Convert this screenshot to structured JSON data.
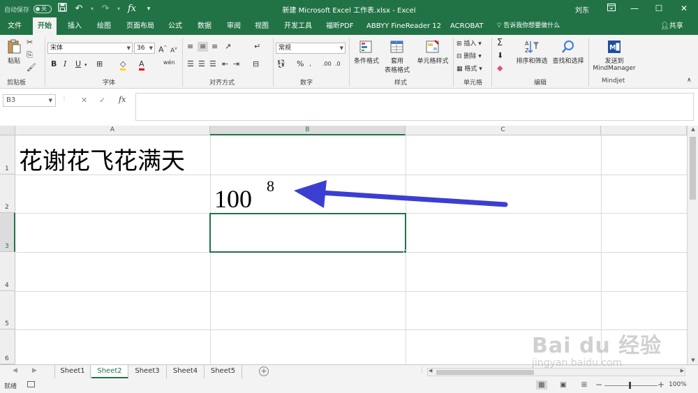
{
  "titlebar": {
    "autosave_label": "自动保存",
    "autosave_state": "关",
    "title": "新建 Microsoft Excel 工作表.xlsx  -  Excel",
    "user": "刘东",
    "icons": {
      "save": "save-icon",
      "undo": "undo-icon",
      "redo": "redo-icon",
      "fx": "fx",
      "customize": "▾"
    }
  },
  "tabs": {
    "items": [
      "文件",
      "开始",
      "插入",
      "绘图",
      "页面布局",
      "公式",
      "数据",
      "审阅",
      "视图",
      "开发工具",
      "福昕PDF",
      "ABBYY FineReader 12",
      "ACROBAT"
    ],
    "active": "开始",
    "tell_me": "告诉我你想要做什么",
    "share": "共享"
  },
  "ribbon": {
    "clipboard": {
      "paste": "粘贴",
      "label": "剪贴板"
    },
    "font": {
      "name": "宋体",
      "size": "36",
      "bold": "B",
      "italic": "I",
      "underline": "U",
      "label": "字体"
    },
    "alignment": {
      "label": "对齐方式"
    },
    "number": {
      "format": "常规",
      "percent": "%",
      "label": "数字"
    },
    "styles": {
      "conditional": "条件格式",
      "table1": "套用",
      "table2": "表格格式",
      "cell_styles": "单元格样式",
      "label": "样式"
    },
    "cells": {
      "insert": "插入",
      "delete": "删除",
      "format": "格式",
      "label": "单元格"
    },
    "editing": {
      "sort_filter": "排序和筛选",
      "find_select": "查找和选择",
      "label": "编辑"
    },
    "mindjet": {
      "send1": "发送到",
      "send2": "MindManager",
      "label": "Mindjet"
    }
  },
  "formula_bar": {
    "name_box": "B3",
    "fx": "fx",
    "cancel": "✕",
    "enter": "✓",
    "value": ""
  },
  "grid": {
    "columns": [
      "A",
      "B",
      "C"
    ],
    "selected_column": "B",
    "rows": [
      "1",
      "2",
      "3",
      "4",
      "5",
      "6"
    ],
    "selected_row": "3",
    "cells": {
      "A1": "花谢花飞花满天",
      "B2_base": "100",
      "B2_superscript": "8"
    },
    "annotation_color": "#3b3fd1"
  },
  "sheets": {
    "tabs": [
      "Sheet1",
      "Sheet2",
      "Sheet3",
      "Sheet4",
      "Sheet5"
    ],
    "active": "Sheet2",
    "add": "+"
  },
  "status": {
    "ready": "就绪",
    "zoom": "100%"
  },
  "watermark": {
    "main": "Bai du 经验",
    "sub": "jingyan.baidu.com"
  },
  "colors": {
    "accent": "#217346",
    "ribbon_bg": "#f3f3f3",
    "arrow": "#3b3fd1"
  }
}
